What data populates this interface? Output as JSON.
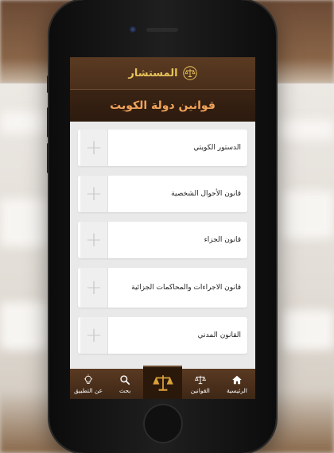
{
  "app": {
    "logo_text": "المستشار"
  },
  "page": {
    "title": "قوانين دولة الكويت"
  },
  "laws": [
    {
      "label": "الدستور الكويتي",
      "icon": "plus-icon"
    },
    {
      "label": "قانون الأحوال الشخصية",
      "icon": "plus-icon"
    },
    {
      "label": "قانون الجزاء",
      "icon": "plus-icon"
    },
    {
      "label": "قانون الاجراءات والمحاكمات الجزائية",
      "icon": "plus-icon"
    },
    {
      "label": "القانون المدني",
      "icon": "plus-icon"
    }
  ],
  "tabbar": {
    "home": {
      "label": "الرئيسية",
      "icon": "house-icon"
    },
    "laws": {
      "label": "القوانين",
      "icon": "scales-icon"
    },
    "center": {
      "icon": "scales-icon"
    },
    "search": {
      "label": "بحث",
      "icon": "search-icon"
    },
    "about": {
      "label": "عن التطبيق",
      "icon": "lightbulb-icon"
    }
  },
  "colors": {
    "header_brown": "#4a2f1b",
    "title_orange": "#f0a35a",
    "logo_gold": "#e8c35a"
  }
}
